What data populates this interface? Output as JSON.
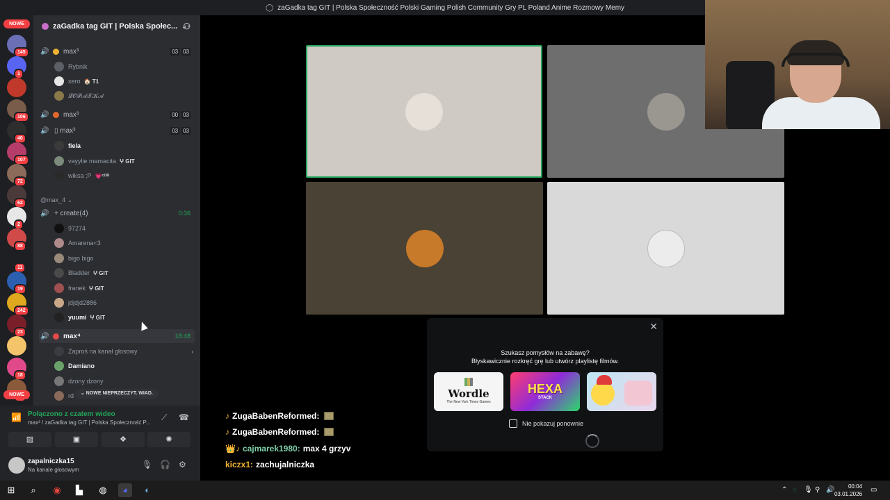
{
  "window": {
    "title": "zaGadka tag GIT | Polska Społeczność Polski Gaming Polish Community Gry PL Poland Anime Rozmowy Memy"
  },
  "rail": {
    "top_badge": "NOWE",
    "bottom_badge": "NOWE",
    "servers": [
      {
        "badge": "145",
        "color": "#6b6fb5"
      },
      {
        "badge": "1",
        "color": "#5865f2"
      },
      {
        "badge": "",
        "color": "#c0392b"
      },
      {
        "badge": "106",
        "color": "#7a5c4a"
      },
      {
        "badge": "40",
        "color": "#2e2e2e"
      },
      {
        "badge": "107",
        "color": "#b63d6a"
      },
      {
        "badge": "72",
        "color": "#8d6b5a"
      },
      {
        "badge": "62",
        "color": "#4a3a3a"
      },
      {
        "badge": "2",
        "color": "#e7e7e7"
      },
      {
        "badge": "88",
        "color": "#d14a4a"
      },
      {
        "badge": "11",
        "color": "#1e1f22"
      },
      {
        "badge": "19",
        "color": "#2c5fb0"
      },
      {
        "badge": "242",
        "color": "#e0a81e"
      },
      {
        "badge": "23",
        "color": "#7a1f2a"
      },
      {
        "badge": "",
        "color": "#f3c46a"
      },
      {
        "badge": "18",
        "color": "#e04a8a"
      },
      {
        "badge": "41",
        "color": "#8a5a3a"
      }
    ]
  },
  "guild": {
    "name": "zaGadka tag GIT | Polska Społec...",
    "chevron": "⌄"
  },
  "channels": {
    "c1": {
      "name": "max³",
      "count1": "03",
      "count2": "03",
      "users": [
        {
          "name": "Rybnik",
          "tag": ""
        },
        {
          "name": "xero",
          "tag": "🏠 T1"
        },
        {
          "name": "𝓛𝓞𝓟𝓐𝓣𝓚𝓐",
          "tag": ""
        }
      ]
    },
    "c2": {
      "name": "max³",
      "count1": "00",
      "count2": "03"
    },
    "c3": {
      "name": "▯ max³",
      "count1": "03",
      "count2": "03",
      "users": [
        {
          "name": "fiela",
          "tag": ""
        },
        {
          "name": "vayylie mamacita",
          "tag": "ⵖ GIT"
        },
        {
          "name": "wiksa ;P",
          "tag": "💗ᶜᴼᴰ"
        }
      ]
    },
    "category": "@max_4 ⌄",
    "c4": {
      "name": "+ create(4)",
      "time": "0:36",
      "users": [
        {
          "name": "97274",
          "tag": ""
        },
        {
          "name": "Amarena<3",
          "tag": ""
        },
        {
          "name": "bigo bigo",
          "tag": ""
        },
        {
          "name": "Bladder",
          "tag": "ⵖ GIT"
        },
        {
          "name": "franek",
          "tag": "ⵖ GIT"
        },
        {
          "name": "jdjdjd2886",
          "tag": ""
        },
        {
          "name": "yuumi",
          "tag": "ⵖ GIT"
        }
      ]
    },
    "c5": {
      "name": "max⁴",
      "time": "18:48",
      "users": [
        {
          "name": "Zaproś na kanał głosowy",
          "tag": "›"
        },
        {
          "name": "Damiano",
          "tag": ""
        },
        {
          "name": "dzony dzony",
          "tag": ""
        },
        {
          "name": "rd",
          "tag": ""
        }
      ]
    },
    "new_unread": "⌄ NOWE NIEPRZECZYT. WIAD."
  },
  "voice": {
    "title": "Połączono z czatem wideo",
    "subtitle": "max³ / zaGadka tag GIT | Polska Społeczność P...",
    "user": "zapalniczka15",
    "status": "Na kanale głosowym"
  },
  "popup": {
    "line1": "Szukasz pomysłów na zabawę?",
    "line2": "Błyskawicznie rozkręć grę lub utwórz playlistę filmów.",
    "games": [
      {
        "title": "Wordle",
        "subtitle": "The New York Times Games"
      },
      {
        "title": "HEXA",
        "subtitle": "STACK"
      },
      {
        "title": "",
        "subtitle": ""
      }
    ],
    "checkbox": "Nie pokazuj ponownie"
  },
  "chat": [
    {
      "user": "ZugaBabenReformed:",
      "msg": "",
      "prefix": "♪"
    },
    {
      "user": "ZugaBabenReformed:",
      "msg": "",
      "prefix": "♪"
    },
    {
      "user": "cajmarek1980:",
      "msg": "max 4 grzyv",
      "prefix": "👑♪"
    },
    {
      "user": "kiczx1:",
      "msg": "zachujalniczka",
      "prefix": ""
    }
  ],
  "taskbar": {
    "time": "00:04",
    "date": "03.01.2026"
  },
  "colors": {
    "green": "#23a55a",
    "red": "#f23f43",
    "bg": "#2b2d31"
  }
}
